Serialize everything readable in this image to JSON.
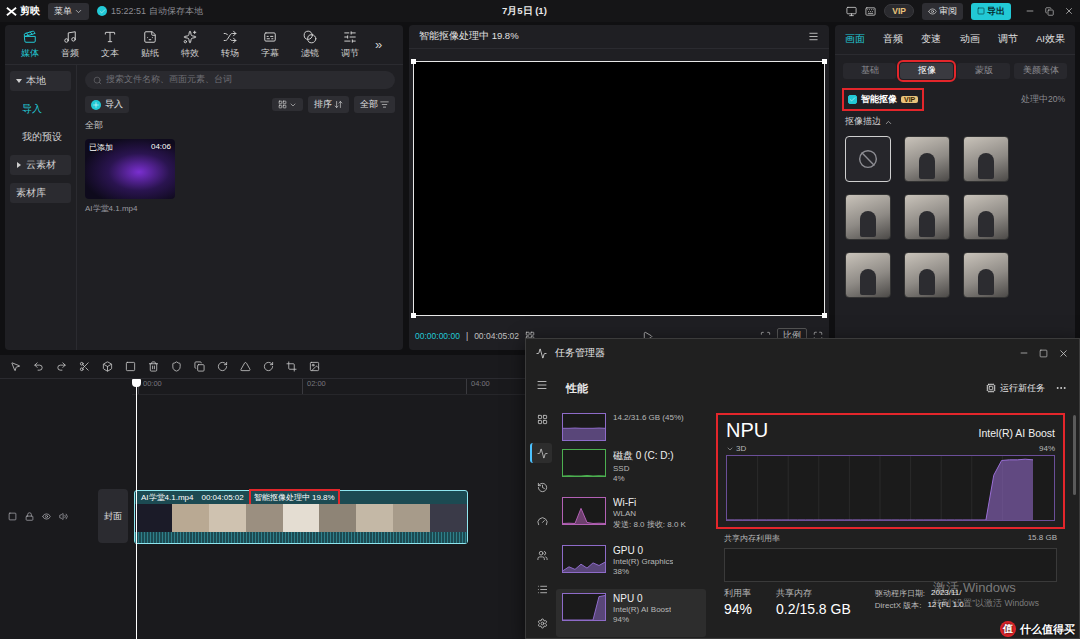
{
  "topbar": {
    "logo": "剪映",
    "menu": "菜单",
    "autosave": "15:22:51 自动保存本地",
    "title": "7月5日 (1)",
    "vip": "VIP",
    "review": "审阅",
    "export": "导出"
  },
  "media": {
    "tabs": [
      {
        "label": "媒体",
        "selected": true
      },
      {
        "label": "音频",
        "selected": false
      },
      {
        "label": "文本",
        "selected": false
      },
      {
        "label": "贴纸",
        "selected": false
      },
      {
        "label": "特效",
        "selected": false
      },
      {
        "label": "转场",
        "selected": false
      },
      {
        "label": "字幕",
        "selected": false
      },
      {
        "label": "滤镜",
        "selected": false
      },
      {
        "label": "调节",
        "selected": false
      }
    ],
    "more": "»",
    "sidebar": [
      {
        "label": "本地",
        "kind": "group",
        "expanded": true,
        "selected": false
      },
      {
        "label": "导入",
        "kind": "sub",
        "selected": true
      },
      {
        "label": "我的预设",
        "kind": "sub",
        "selected": false
      },
      {
        "label": "云素材",
        "kind": "group",
        "expanded": false,
        "selected": false
      },
      {
        "label": "素材库",
        "kind": "button",
        "selected": false
      }
    ],
    "search": {
      "placeholder": "搜索文件名称、画面元素、台词"
    },
    "import": "导入",
    "sort": "排序",
    "filter": "全部",
    "section": "全部",
    "items": [
      {
        "badge": "已添加",
        "duration": "04:06",
        "name": "AI学堂4.1.mp4"
      }
    ]
  },
  "player": {
    "title": "智能抠像处理中 19.8%",
    "current": "00:00:00:00",
    "total": "00:04:05:02",
    "ratio": "比例"
  },
  "inspector": {
    "tabs": [
      {
        "label": "画面",
        "selected": true
      },
      {
        "label": "音频",
        "selected": false
      },
      {
        "label": "变速",
        "selected": false
      },
      {
        "label": "动画",
        "selected": false
      },
      {
        "label": "调节",
        "selected": false
      },
      {
        "label": "AI效果",
        "selected": false
      }
    ],
    "subtabs": [
      {
        "label": "基础",
        "selected": false,
        "annotated": false
      },
      {
        "label": "抠像",
        "selected": true,
        "annotated": true
      },
      {
        "label": "蒙版",
        "selected": false,
        "annotated": false
      },
      {
        "label": "美颜美体",
        "selected": false,
        "annotated": false
      }
    ],
    "smart_cutout": {
      "label": "智能抠像",
      "checked": true,
      "badge": "VIP",
      "status": "处理中20%",
      "annotated": true
    },
    "stroke": {
      "label": "抠像描边",
      "expanded": true
    },
    "presets": [
      {
        "kind": "none",
        "selected": true
      },
      {
        "kind": "photo",
        "selected": false
      },
      {
        "kind": "photo",
        "selected": false
      },
      {
        "kind": "photo",
        "selected": false
      },
      {
        "kind": "photo",
        "selected": false
      },
      {
        "kind": "photo",
        "selected": false
      },
      {
        "kind": "photo",
        "selected": false
      },
      {
        "kind": "photo",
        "selected": false
      },
      {
        "kind": "photo",
        "selected": false
      }
    ]
  },
  "timeline": {
    "ruler": [
      "00:00",
      "02:00",
      "04:00"
    ],
    "cover": "封面",
    "clip": {
      "name": "AI学堂4.1.mp4",
      "duration": "00:04:05:02",
      "status": "智能抠像处理中 19.8%",
      "annotated": true
    }
  },
  "task_manager": {
    "title": "任务管理器",
    "page": "性能",
    "run_task": "运行新任务",
    "resources": [
      {
        "name": "",
        "sub": "14.2/31.6 GB (45%)",
        "value": "",
        "selected": false,
        "color": "#8e6bc9",
        "graph": [
          45,
          45,
          46,
          45,
          45,
          45,
          46,
          45
        ]
      },
      {
        "name": "磁盘 0 (C: D:)",
        "sub": "SSD",
        "value": "4%",
        "selected": false,
        "color": "#4caf50",
        "graph": [
          0,
          1,
          0,
          0,
          2,
          0,
          1,
          0
        ]
      },
      {
        "name": "Wi-Fi",
        "sub": "WLAN",
        "value": "发送: 8.0 接收: 8.0 K",
        "selected": false,
        "color": "#b361b5",
        "graph": [
          2,
          3,
          2,
          60,
          6,
          2,
          3,
          2
        ]
      },
      {
        "name": "GPU 0",
        "sub": "Intel(R) Graphics",
        "value": "38%",
        "selected": false,
        "color": "#8e6bc9",
        "graph": [
          5,
          20,
          10,
          30,
          15,
          35,
          25,
          38
        ]
      },
      {
        "name": "NPU 0",
        "sub": "Intel(R) AI Boost",
        "value": "94%",
        "selected": true,
        "color": "#8e6bc9",
        "graph": [
          0,
          0,
          0,
          0,
          0,
          0,
          90,
          94
        ]
      }
    ],
    "detail": {
      "name": "NPU",
      "device": "Intel(R) AI Boost",
      "engine": "3D",
      "engine_max": "94%",
      "annotated": true,
      "series": [
        0,
        0,
        0,
        0,
        0,
        0,
        0,
        0,
        0,
        0,
        0,
        0,
        0,
        0,
        0,
        0,
        0,
        0,
        0,
        0,
        0,
        0,
        0,
        0,
        0,
        0,
        0,
        0,
        0,
        0,
        0,
        0,
        0,
        0,
        70,
        93,
        94,
        94,
        95,
        94
      ],
      "shared_label": "共享内存利用率",
      "shared_max": "15.8 GB",
      "stats": [
        {
          "label": "利用率",
          "value": "94%"
        },
        {
          "label": "共享内存",
          "value": "0.2/15.8 GB"
        }
      ],
      "driver": [
        {
          "label": "驱动程序日期:",
          "value": "2023/11/"
        },
        {
          "label": "DirectX 版本:",
          "value": "12 (FL 1.0"
        }
      ]
    }
  },
  "watermarks": {
    "windows": [
      "激活 Windows",
      "转到“设置”以激活 Windows"
    ],
    "site": {
      "mark": "值",
      "name": "什么值得买"
    }
  }
}
